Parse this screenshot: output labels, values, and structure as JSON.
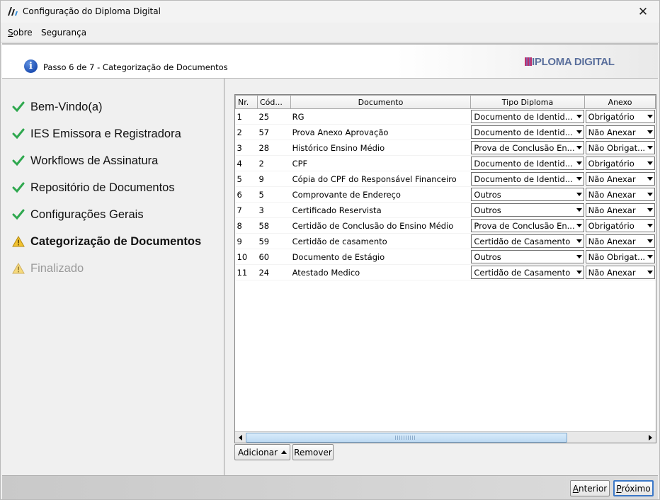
{
  "window": {
    "title": "Configuração do Diploma Digital",
    "close": "✕"
  },
  "menu": [
    {
      "label": "Sobre",
      "mnemonic": "S",
      "rest": "obre"
    },
    {
      "label": "Segurança"
    }
  ],
  "banner": {
    "step_text": "Passo 6 de 7 - Categorização de Documentos",
    "brand": "IPLOMA DIGITAL",
    "info_glyph": "i"
  },
  "steps": [
    {
      "label": "Bem-Vindo(a)",
      "status": "done"
    },
    {
      "label": "IES Emissora e Registradora",
      "status": "done"
    },
    {
      "label": "Workflows de Assinatura",
      "status": "done"
    },
    {
      "label": "Repositório de Documentos",
      "status": "done"
    },
    {
      "label": "Configurações Gerais",
      "status": "done"
    },
    {
      "label": "Categorização de Documentos",
      "status": "current"
    },
    {
      "label": "Finalizado",
      "status": "pending"
    }
  ],
  "table": {
    "headers": [
      "Nr.",
      "Cód...",
      "Documento",
      "Tipo Diploma",
      "Anexo"
    ],
    "rows": [
      {
        "nr": "1",
        "cod": "25",
        "documento": "RG",
        "tipo": "Documento de Identid...",
        "anexo": "Obrigatório"
      },
      {
        "nr": "2",
        "cod": "57",
        "documento": "Prova Anexo Aprovação",
        "tipo": "Documento de Identid...",
        "anexo": "Não Anexar"
      },
      {
        "nr": "3",
        "cod": "28",
        "documento": "Histórico Ensino Médio",
        "tipo": "Prova de Conclusão En...",
        "anexo": "Não Obrigat..."
      },
      {
        "nr": "4",
        "cod": "2",
        "documento": "CPF",
        "tipo": "Documento de Identid...",
        "anexo": "Obrigatório"
      },
      {
        "nr": "5",
        "cod": "9",
        "documento": "Cópia do CPF do Responsável Financeiro",
        "tipo": "Documento de Identid...",
        "anexo": "Não Anexar"
      },
      {
        "nr": "6",
        "cod": "5",
        "documento": "Comprovante de Endereço",
        "tipo": "Outros",
        "anexo": "Não Anexar"
      },
      {
        "nr": "7",
        "cod": "3",
        "documento": "Certificado Reservista",
        "tipo": "Outros",
        "anexo": "Não Anexar"
      },
      {
        "nr": "8",
        "cod": "58",
        "documento": "Certidão de Conclusão do Ensino Médio",
        "tipo": "Prova de Conclusão En...",
        "anexo": "Obrigatório"
      },
      {
        "nr": "9",
        "cod": "59",
        "documento": "Certidão de casamento",
        "tipo": "Certidão de Casamento",
        "anexo": "Não Anexar"
      },
      {
        "nr": "10",
        "cod": "60",
        "documento": "Documento de Estágio",
        "tipo": "Outros",
        "anexo": "Não Obrigat..."
      },
      {
        "nr": "11",
        "cod": "24",
        "documento": "Atestado Medico",
        "tipo": "Certidão de Casamento",
        "anexo": "Não Anexar"
      }
    ]
  },
  "actions": {
    "add": "Adicionar",
    "remove": "Remover"
  },
  "footer": {
    "back": {
      "label": "Anterior",
      "mnemonic": "A",
      "rest": "nterior"
    },
    "next": {
      "label": "Próximo",
      "mnemonic": "P",
      "rest": "róximo"
    }
  },
  "colors": {
    "check": "#2fa84f",
    "warning": "#f2c230",
    "accent": "#1e4fb3"
  }
}
